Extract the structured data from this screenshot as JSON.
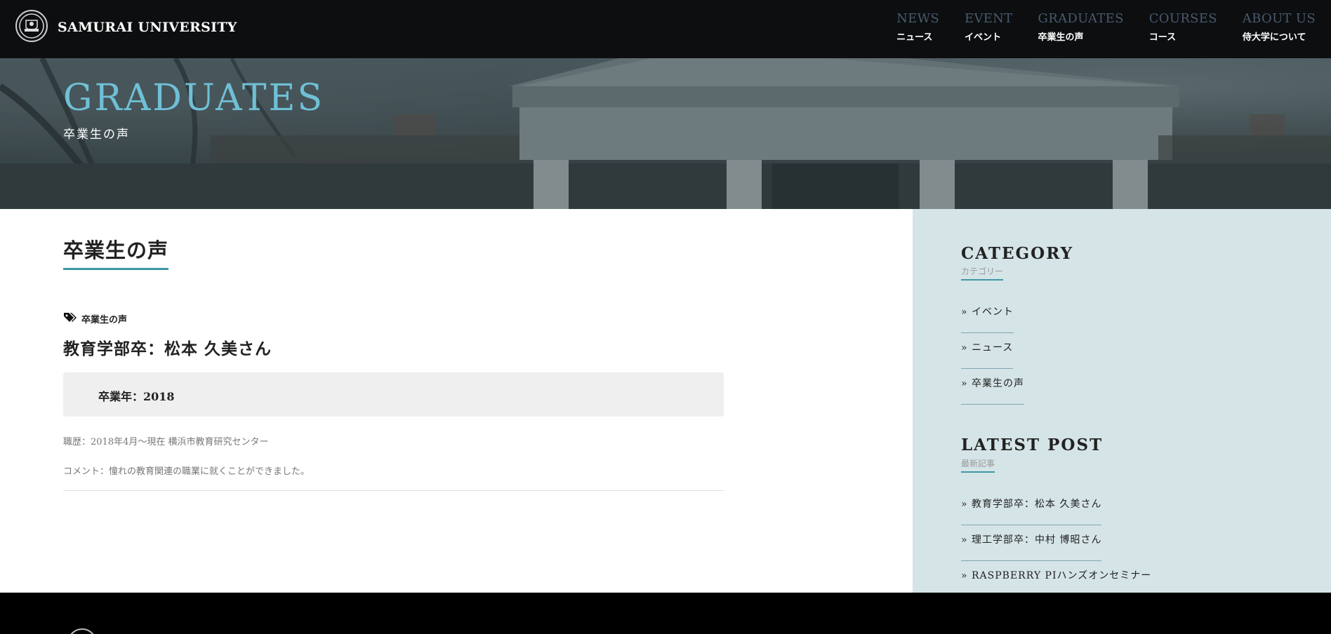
{
  "header": {
    "brand": "SAMURAI UNIVERSITY",
    "nav": [
      {
        "en": "NEWS",
        "ja": "ニュース"
      },
      {
        "en": "EVENT",
        "ja": "イベント"
      },
      {
        "en": "GRADUATES",
        "ja": "卒業生の声"
      },
      {
        "en": "COURSES",
        "ja": "コース"
      },
      {
        "en": "ABOUT US",
        "ja": "侍大学について"
      }
    ]
  },
  "hero": {
    "title": "GRADUATES",
    "subtitle": "卒業生の声"
  },
  "main": {
    "page_title": "卒業生の声",
    "post": {
      "category": "卒業生の声",
      "title": "教育学部卒：松本 久美さん",
      "graduation_year": "卒業年：2018",
      "career": "職歴：2018年4月～現在 横浜市教育研究センター",
      "comment": "コメント：憧れの教育関連の職業に就くことができました。"
    }
  },
  "sidebar": {
    "category_heading": "CATEGORY",
    "category_sub": "カテゴリー",
    "categories": [
      "» イベント",
      "» ニュース",
      "» 卒業生の声"
    ],
    "latest_heading": "LATEST POST",
    "latest_sub": "最新記事",
    "latest": [
      "» 教育学部卒：松本 久美さん",
      "» 理工学部卒：中村 博昭さん",
      "» RASPBERRY PIハンズオンセミナー"
    ]
  },
  "colors": {
    "accent": "#3f98a4",
    "hero_title": "#6fc0d6",
    "sidebar_bg": "#d5e4e7",
    "header_bg": "#0c0e10"
  }
}
